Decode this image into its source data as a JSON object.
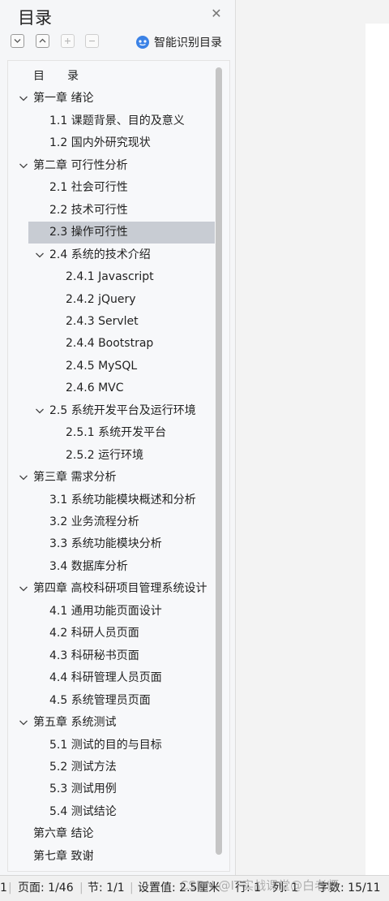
{
  "panel": {
    "title": "目录",
    "smart_toc_label": "智能识别目录"
  },
  "toc": [
    {
      "text": "目　　录"
    },
    {
      "text": "第一章  绪论"
    },
    {
      "text": "1.1  课题背景、目的及意义"
    },
    {
      "text": "1.2  国内外研究现状"
    },
    {
      "text": "第二章  可行性分析"
    },
    {
      "text": "2.1  社会可行性"
    },
    {
      "text": "2.2  技术可行性"
    },
    {
      "text": "2.3  操作可行性"
    },
    {
      "text": "2.4  系统的技术介绍"
    },
    {
      "text": "2.4.1 Javascript"
    },
    {
      "text": "2.4.2 jQuery"
    },
    {
      "text": "2.4.3 Servlet"
    },
    {
      "text": "2.4.4 Bootstrap"
    },
    {
      "text": "2.4.5 MySQL"
    },
    {
      "text": "2.4.6 MVC"
    },
    {
      "text": "2.5  系统开发平台及运行环境"
    },
    {
      "text": "2.5.1  系统开发平台"
    },
    {
      "text": "2.5.2  运行环境"
    },
    {
      "text": "第三章  需求分析"
    },
    {
      "text": "3.1  系统功能模块概述和分析"
    },
    {
      "text": "3.2  业务流程分析"
    },
    {
      "text": "3.3  系统功能模块分析"
    },
    {
      "text": "3.4  数据库分析"
    },
    {
      "text": "第四章  高校科研项目管理系统设计"
    },
    {
      "text": "4.1    通用功能页面设计"
    },
    {
      "text": "4.2    科研人员页面"
    },
    {
      "text": "4.3    科研秘书页面"
    },
    {
      "text": "4.4    科研管理人员页面"
    },
    {
      "text": "4.5    系统管理员页面"
    },
    {
      "text": "第五章  系统测试"
    },
    {
      "text": "5.1  测试的目的与目标"
    },
    {
      "text": "5.2  测试方法"
    },
    {
      "text": "5.3  测试用例"
    },
    {
      "text": "5.4  测试结论"
    },
    {
      "text": "第六章  结论"
    },
    {
      "text": "第七章  致谢"
    }
  ],
  "selected_index": 7,
  "status": {
    "left_num": "1",
    "page": "页面: 1/46",
    "section": "节: 1/1",
    "setting": "设置值: 2.5厘米",
    "row": "行: 1",
    "col": "列: 1",
    "wordcount": "字数: 15/11"
  },
  "watermark": "CSDN @IT实战课堂@白老师",
  "colors": {
    "selected_bg": "#c8ccd3",
    "accent": "#3b82e6"
  }
}
